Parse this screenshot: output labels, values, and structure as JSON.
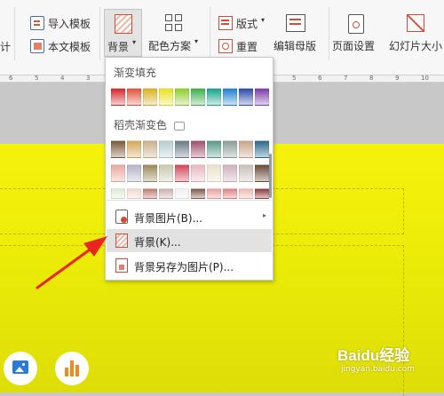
{
  "toolbar": {
    "partial_left_label": "计",
    "import_template": "导入模板",
    "text_template": "本文模板",
    "background": "背景",
    "color_scheme": "配色方案",
    "layout": "版式",
    "reset": "重置",
    "edit_master": "编辑母版",
    "page_setup": "页面设置",
    "slide_size": "幻灯片大小"
  },
  "ruler": {
    "ticks": [
      "6",
      "5",
      "4",
      "3",
      "2",
      "1",
      "0",
      "1",
      "2",
      "3",
      "4",
      "5",
      "6",
      "7",
      "8",
      "9",
      "10"
    ]
  },
  "menu": {
    "gradient_fill_title": "渐变填充",
    "daoke_gradient_title": "稻壳渐变色",
    "gradient_swatches": [
      "#d6262a",
      "#e0523a",
      "#d8b21e",
      "#e8e21c",
      "#8fcd2c",
      "#3dae4c",
      "#16a38c",
      "#1f7fd0",
      "#2a4aa8",
      "#7a3aa6"
    ],
    "daoke_rows": [
      [
        "#7a5a3a",
        "#d6a657",
        "#c9b28a",
        "#b7ccd0",
        "#6a7a86",
        "#a0506a",
        "#5a9a8a",
        "#8c9c98",
        "#c8a58a",
        "#2a6a8a"
      ],
      [
        "#e8a8a0",
        "#b4b4c8",
        "#9a8a5a",
        "#c8c8b0",
        "#d4485a",
        "#e8b8c0",
        "#e8e0c8",
        "#d0b0c0",
        "#c8c0b8",
        "#6a4a3a"
      ],
      [
        "#e0e8d8",
        "#f0d8d0",
        "#c07870",
        "#c8b0b0",
        "#f0f0f0",
        "#7a5a4a",
        "#e8a0a0",
        "#e08080",
        "#f0b8b0",
        "#8a3a3a"
      ]
    ],
    "items": [
      {
        "label": "背景图片(B)..."
      },
      {
        "label": "背景(K)..."
      },
      {
        "label": "背景另存为图片(P)..."
      }
    ]
  },
  "watermark": {
    "brand": "Baidu经验",
    "url": "jingyan.baidu.com"
  },
  "colors": {
    "slide_yellow": "#f2ef0a",
    "arrow_red": "#e8261e",
    "icon_blue": "#2a7bd6",
    "icon_orange": "#f08a1e",
    "highlight": "#e2e2e2"
  }
}
